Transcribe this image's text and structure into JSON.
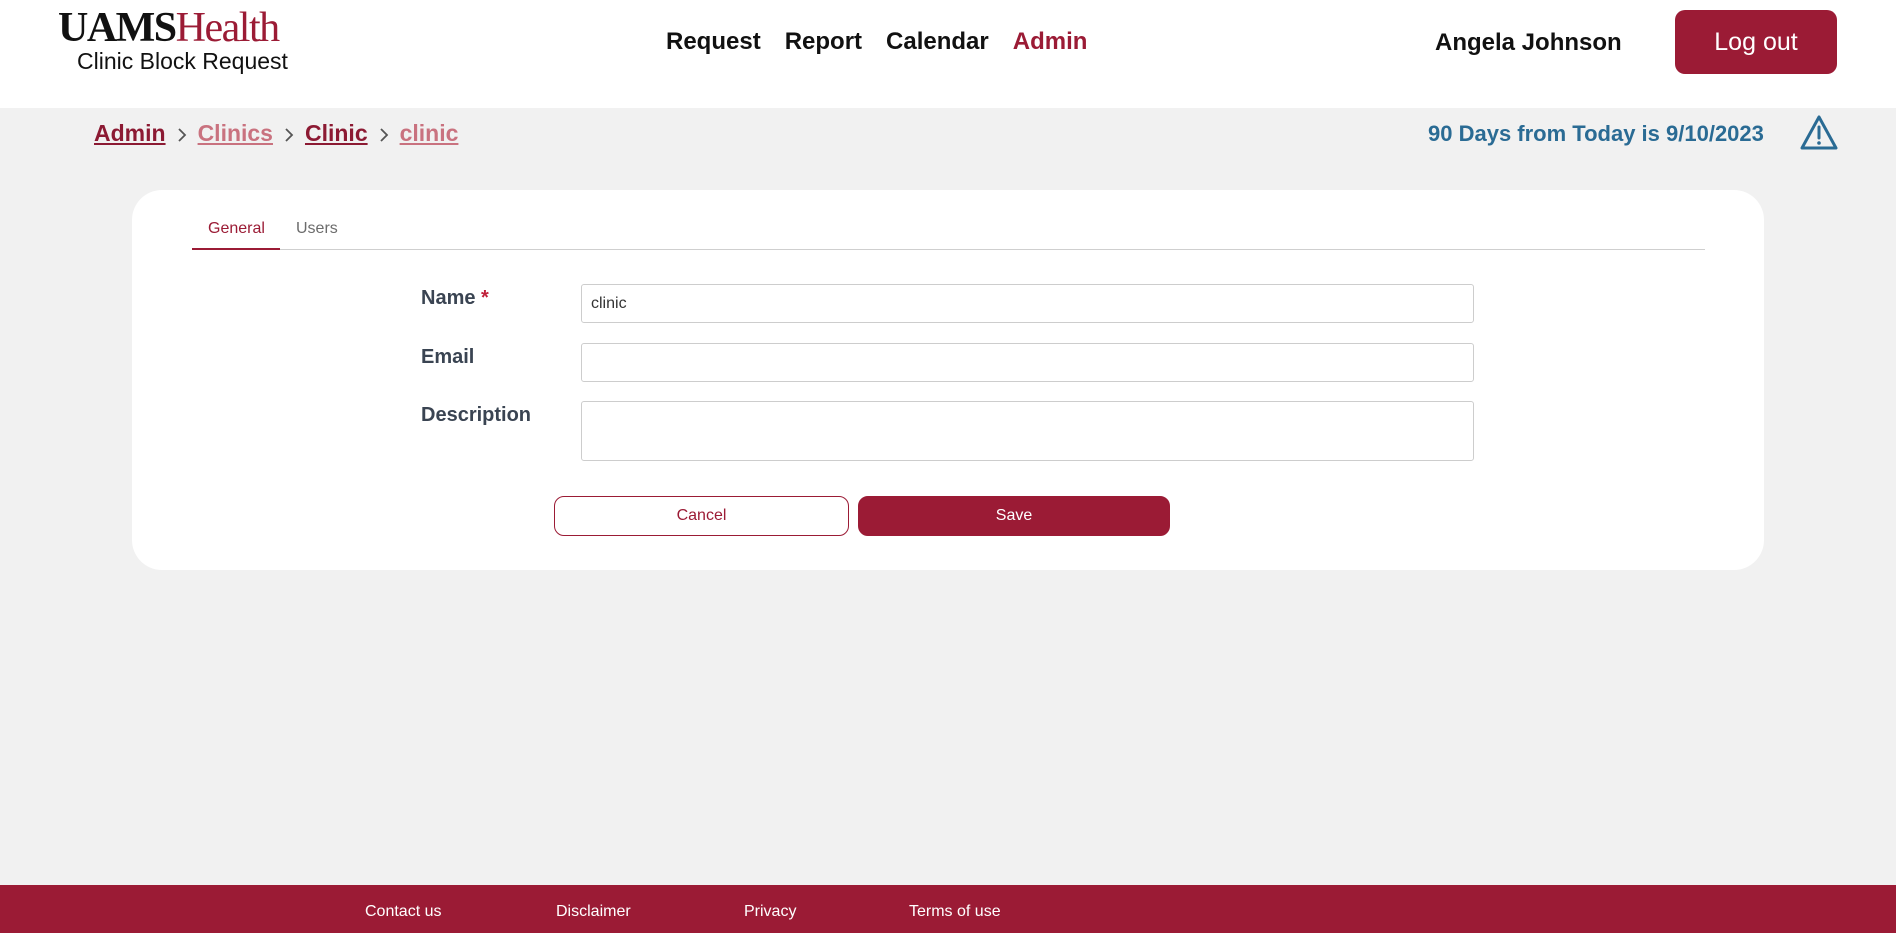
{
  "logo": {
    "brand_main": "UAMS",
    "brand_accent": "Health",
    "subtitle": "Clinic Block Request"
  },
  "nav": {
    "items": [
      "Request",
      "Report",
      "Calendar",
      "Admin"
    ],
    "active": "Admin"
  },
  "user": {
    "name": "Angela Johnson",
    "logout_label": "Log out"
  },
  "breadcrumb": [
    "Admin",
    "Clinics",
    "Clinic",
    "clinic"
  ],
  "notice": {
    "text": "90 Days from Today is 9/10/2023",
    "icon": "warning-triangle-icon"
  },
  "tabs": [
    "General",
    "Users"
  ],
  "form": {
    "name_label": "Name",
    "required_marker": "*",
    "name_value": "clinic",
    "email_label": "Email",
    "email_value": "",
    "description_label": "Description",
    "description_value": "",
    "cancel_label": "Cancel",
    "save_label": "Save"
  },
  "footer": {
    "links": [
      "Contact us",
      "Disclaimer",
      "Privacy",
      "Terms of use"
    ]
  },
  "colors": {
    "brand": "#9b1b35",
    "notice": "#2a6b94",
    "background": "#f1f1f1"
  }
}
